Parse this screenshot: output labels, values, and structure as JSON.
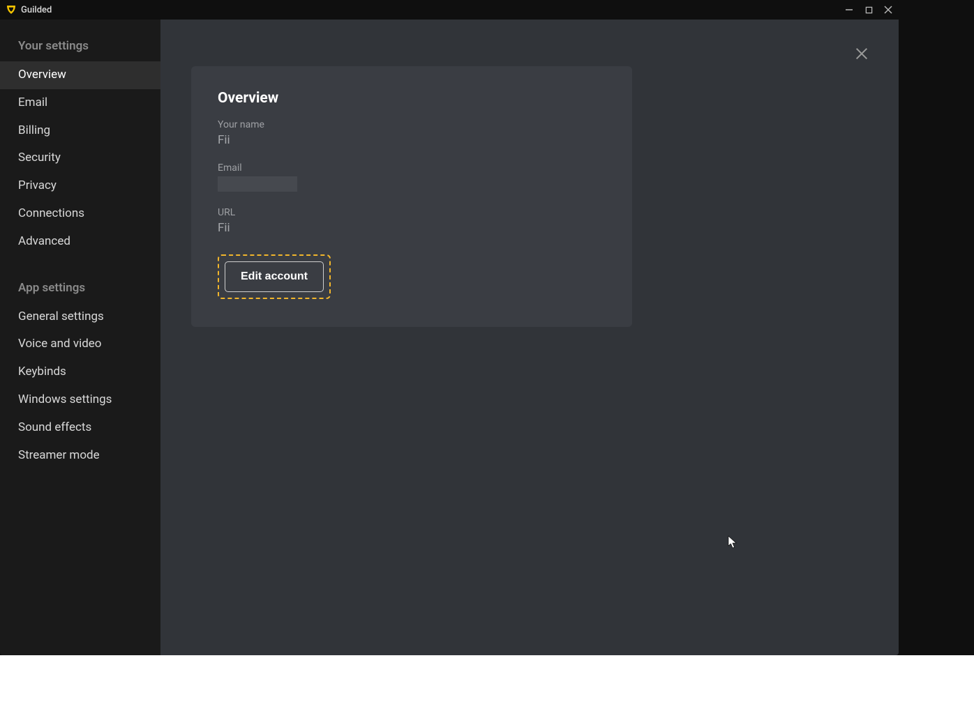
{
  "titlebar": {
    "app_name": "Guilded"
  },
  "sidebar": {
    "sections": [
      {
        "title": "Your settings",
        "items": [
          {
            "label": "Overview",
            "active": true
          },
          {
            "label": "Email",
            "active": false
          },
          {
            "label": "Billing",
            "active": false
          },
          {
            "label": "Security",
            "active": false
          },
          {
            "label": "Privacy",
            "active": false
          },
          {
            "label": "Connections",
            "active": false
          },
          {
            "label": "Advanced",
            "active": false
          }
        ]
      },
      {
        "title": "App settings",
        "items": [
          {
            "label": "General settings",
            "active": false
          },
          {
            "label": "Voice and video",
            "active": false
          },
          {
            "label": "Keybinds",
            "active": false
          },
          {
            "label": "Windows settings",
            "active": false
          },
          {
            "label": "Sound effects",
            "active": false
          },
          {
            "label": "Streamer mode",
            "active": false
          }
        ]
      }
    ]
  },
  "panel": {
    "title": "Overview",
    "fields": {
      "name_label": "Your name",
      "name_value": "Fii",
      "email_label": "Email",
      "email_value": "",
      "url_label": "URL",
      "url_value": "Fii"
    },
    "edit_button": "Edit account"
  }
}
